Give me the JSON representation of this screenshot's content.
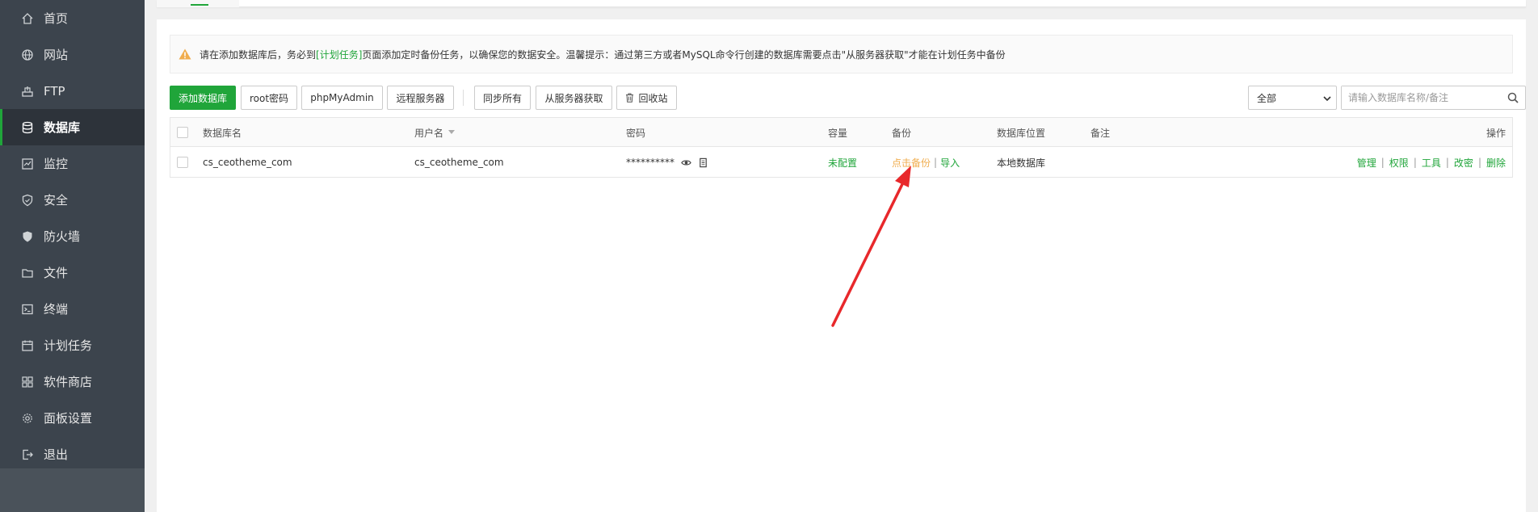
{
  "sidebar": {
    "items": [
      {
        "label": "首页",
        "icon": "home-icon"
      },
      {
        "label": "网站",
        "icon": "globe-icon"
      },
      {
        "label": "FTP",
        "icon": "ftp-icon"
      },
      {
        "label": "数据库",
        "icon": "database-icon",
        "active": true
      },
      {
        "label": "监控",
        "icon": "monitor-icon"
      },
      {
        "label": "安全",
        "icon": "shield-icon"
      },
      {
        "label": "防火墙",
        "icon": "firewall-icon"
      },
      {
        "label": "文件",
        "icon": "folder-icon"
      },
      {
        "label": "终端",
        "icon": "terminal-icon"
      },
      {
        "label": "计划任务",
        "icon": "calendar-icon"
      },
      {
        "label": "软件商店",
        "icon": "apps-icon"
      },
      {
        "label": "面板设置",
        "icon": "gear-icon"
      },
      {
        "label": "退出",
        "icon": "logout-icon"
      }
    ]
  },
  "tip": {
    "before": "请在添加数据库后，务必到",
    "link": "[计划任务]",
    "after": "页面添加定时备份任务，以确保您的数据安全。温馨提示：通过第三方或者MySQL命令行创建的数据库需要点击\"从服务器获取\"才能在计划任务中备份"
  },
  "toolbar": {
    "add_db": "添加数据库",
    "root_pw": "root密码",
    "phpmyadmin": "phpMyAdmin",
    "remote": "远程服务器",
    "sync_all": "同步所有",
    "fetch_server": "从服务器获取",
    "recycle": "回收站",
    "filter_selected": "全部",
    "search_placeholder": "请输入数据库名称/备注"
  },
  "table": {
    "headers": {
      "name": "数据库名",
      "user": "用户名",
      "password": "密码",
      "capacity": "容量",
      "backup": "备份",
      "location": "数据库位置",
      "remark": "备注",
      "actions": "操作"
    },
    "rows": [
      {
        "name": "cs_ceotheme_com",
        "user": "cs_ceotheme_com",
        "password": "**********",
        "capacity": "未配置",
        "backup_link": "点击备份",
        "backup_sep": "|",
        "import": "导入",
        "location": "本地数据库",
        "remark": "",
        "actions": [
          "管理",
          "权限",
          "工具",
          "改密",
          "删除"
        ]
      }
    ]
  },
  "colors": {
    "accent": "#20a53a",
    "sidebar_bg": "#3c444d",
    "backup_link": "#f0ad4e",
    "arrow": "#e8282b"
  }
}
